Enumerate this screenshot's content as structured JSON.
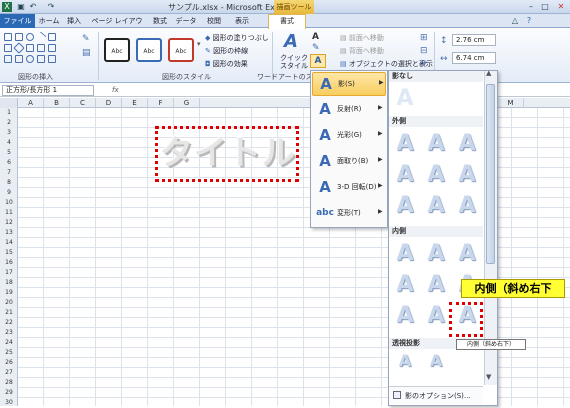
{
  "title_bar": {
    "title": "サンプル.xlsx - Microsoft Excel",
    "context_tab": "描画ツール"
  },
  "tabs": [
    "ファイル",
    "ホーム",
    "挿入",
    "ページ レイアウト",
    "数式",
    "データ",
    "校閲",
    "表示",
    "書式"
  ],
  "ribbon": {
    "insert_shapes_label": "図形の挿入",
    "shape_styles": {
      "label": "図形のスタイル",
      "sample": "Abc",
      "fill": "図形の塗りつぶし",
      "outline": "図形の枠線",
      "effects": "図形の効果"
    },
    "wordart": {
      "quick_styles": "クイック",
      "quick_styles_2": "スタイル",
      "label": "ワードアートのス",
      "text_effects_icon": "A"
    },
    "arrange": {
      "bring_forward": "前面へ移動",
      "send_backward": "背面へ移動",
      "selection_pane": "オブジェクトの選択と表示"
    },
    "size": {
      "height": "2.76 cm",
      "width": "6.74 cm"
    }
  },
  "formula_bar": {
    "name_box": "正方形/長方形 1",
    "fx": "fx"
  },
  "columns": [
    "A",
    "B",
    "C",
    "D",
    "E",
    "F",
    "G",
    "M"
  ],
  "rows": [
    "1",
    "2",
    "3",
    "4",
    "5",
    "6",
    "7",
    "8",
    "9",
    "10",
    "11",
    "12",
    "13",
    "14",
    "15",
    "16",
    "17",
    "18",
    "19",
    "20",
    "21",
    "22",
    "23",
    "24",
    "25",
    "26",
    "27",
    "28",
    "29",
    "30"
  ],
  "wordart_text": "タイトル",
  "effects_menu": [
    {
      "label": "影(S)",
      "icon": "A",
      "selected": true
    },
    {
      "label": "反射(R)",
      "icon": "A"
    },
    {
      "label": "光彩(G)",
      "icon": "A"
    },
    {
      "label": "面取り(B)",
      "icon": "A"
    },
    {
      "label": "3-D 回転(D)",
      "icon": "A"
    },
    {
      "label": "変形(T)",
      "icon": "abc"
    }
  ],
  "gallery": {
    "sections": {
      "none": "影なし",
      "outer": "外側",
      "inner": "内側",
      "perspective": "透視投影"
    },
    "glyph": "A",
    "options": "影のオプション(S)..."
  },
  "callout": "内側（斜め右下",
  "tooltip": "内側（斜め右下）"
}
